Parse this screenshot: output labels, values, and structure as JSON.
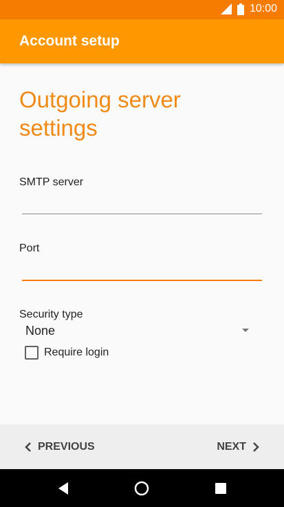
{
  "status_bar": {
    "time": "10:00",
    "icons": [
      "signal-icon",
      "battery-icon"
    ]
  },
  "app_bar": {
    "title": "Account setup"
  },
  "page": {
    "title": "Outgoing server settings"
  },
  "form": {
    "smtp_label": "SMTP server",
    "smtp_value": "",
    "port_label": "Port",
    "port_value": "",
    "security_label": "Security type",
    "security_value": "None",
    "require_login_label": "Require login",
    "require_login_checked": false
  },
  "bottom_nav": {
    "previous_label": "PREVIOUS",
    "next_label": "NEXT"
  },
  "system_nav": {
    "icons": [
      "back-icon",
      "home-icon",
      "recents-icon"
    ]
  },
  "colors": {
    "status_bar": "#f57c00",
    "app_bar": "#ff9800",
    "accent": "#f08a17"
  }
}
